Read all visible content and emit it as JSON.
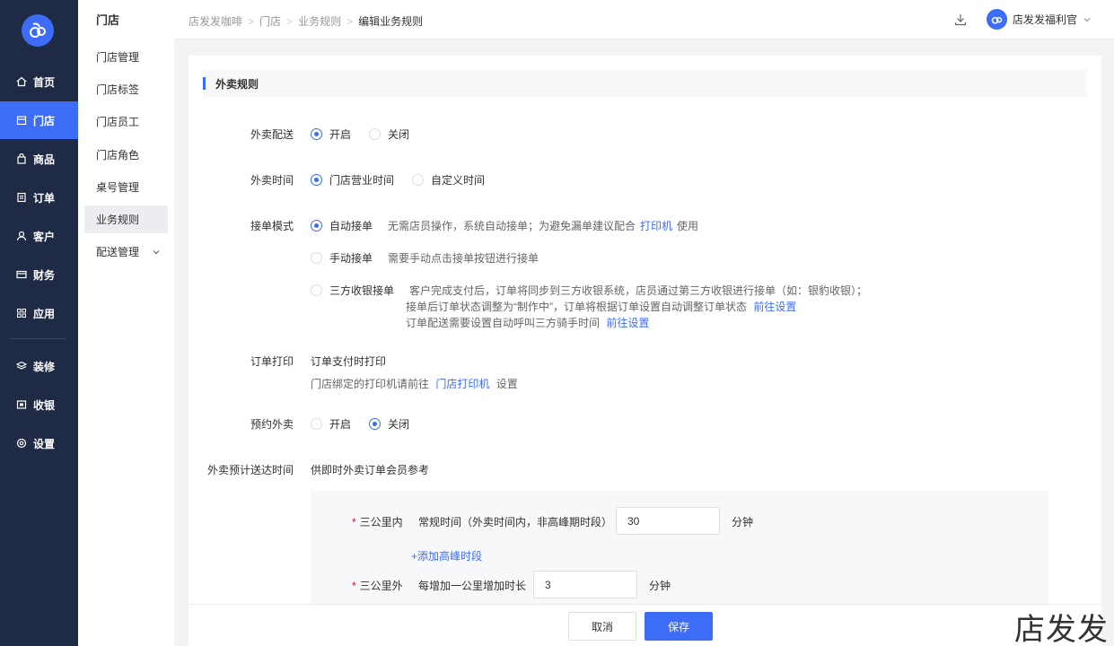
{
  "nav": {
    "items": [
      {
        "label": "首页",
        "icon": "home-icon"
      },
      {
        "label": "门店",
        "icon": "store-icon"
      },
      {
        "label": "商品",
        "icon": "bag-icon"
      },
      {
        "label": "订单",
        "icon": "order-icon"
      },
      {
        "label": "客户",
        "icon": "user-icon"
      },
      {
        "label": "财务",
        "icon": "card-icon"
      },
      {
        "label": "应用",
        "icon": "apps-icon"
      },
      {
        "label": "装修",
        "icon": "layers-icon"
      },
      {
        "label": "收银",
        "icon": "cashier-icon"
      },
      {
        "label": "设置",
        "icon": "settings-icon"
      }
    ],
    "active": "门店",
    "accent": "#3d6cf6",
    "bg": "#1f2a44"
  },
  "subnav": {
    "title": "门店",
    "items": [
      "门店管理",
      "门店标签",
      "门店员工",
      "门店角色",
      "桌号管理",
      "业务规则",
      "配送管理"
    ],
    "active": "业务规则"
  },
  "header": {
    "breadcrumb": [
      "店发发咖啡",
      "门店",
      "业务规则",
      "编辑业务规则"
    ],
    "user_name": "店发发福利官"
  },
  "section": {
    "title": "外卖规则"
  },
  "form": {
    "delivery": {
      "label": "外卖配送",
      "opt_on": "开启",
      "opt_off": "关闭",
      "selected": "开启"
    },
    "delivery_time": {
      "label": "外卖时间",
      "opt_store": "门店营业时间",
      "opt_custom": "自定义时间",
      "selected": "门店营业时间"
    },
    "accept_mode": {
      "label": "接单模式",
      "auto_label": "自动接单",
      "auto_desc": "无需店员操作，系统自动接单；为避免漏单建议配合",
      "auto_link": "打印机",
      "auto_desc_end": "使用",
      "manual_label": "手动接单",
      "manual_desc": "需要手动点击接单按钮进行接单",
      "third_label": "三方收银接单",
      "third_desc1": "客户完成支付后，订单将同步到三方收银系统，店员通过第三方收银进行接单（如：银豹收银）；",
      "third_desc2": "接单后订单状态调整为“制作中”，订单将根据订单设置自动调整订单状态",
      "third_link2": "前往设置",
      "third_desc3": "订单配送需要设置自动呼叫三方骑手时间",
      "third_link3": "前往设置",
      "selected": "自动接单"
    },
    "print": {
      "label": "订单打印",
      "value": "订单支付时打印",
      "hint_pre": "门店绑定的打印机请前往",
      "hint_link": "门店打印机",
      "hint_post": "设置"
    },
    "reserve": {
      "label": "预约外卖",
      "opt_on": "开启",
      "opt_off": "关闭",
      "selected": "关闭"
    },
    "eta": {
      "label": "外卖预计送达时间",
      "hint": "供即时外卖订单会员参考",
      "within_label": "三公里内",
      "within_desc": "常规时间（外卖时间内，非高峰期时段）",
      "within_value": "30",
      "within_unit": "分钟",
      "add_peak": "+添加高峰时段",
      "beyond_label": "三公里外",
      "beyond_desc": "每增加一公里增加时长",
      "beyond_value": "3",
      "beyond_unit": "分钟"
    }
  },
  "footer": {
    "cancel": "取消",
    "save": "保存"
  },
  "watermark": "店发发"
}
